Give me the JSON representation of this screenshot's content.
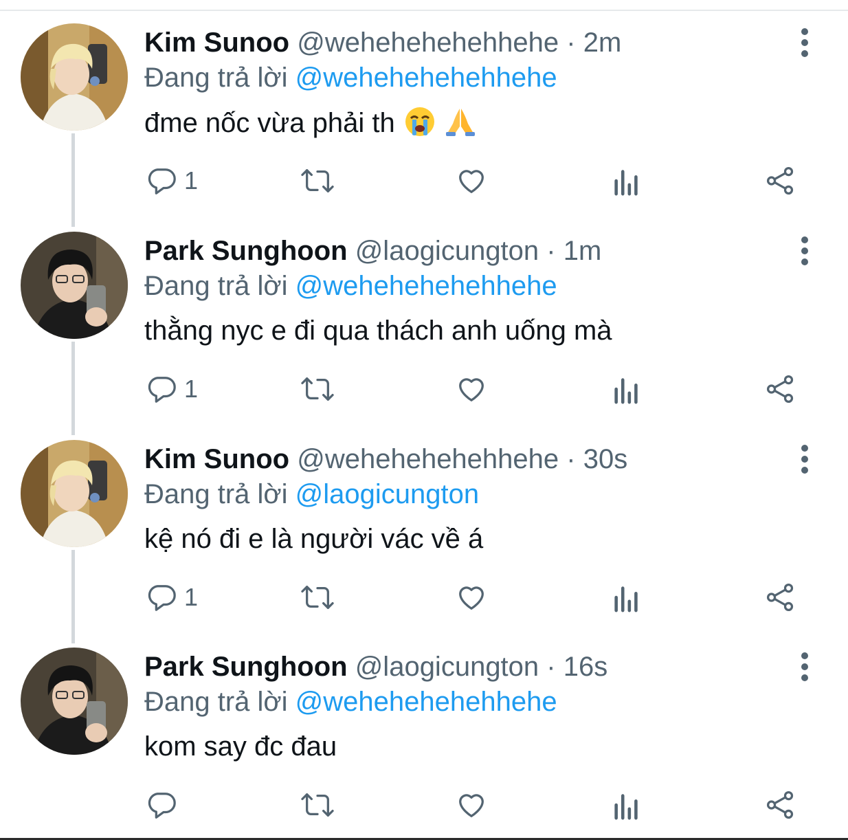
{
  "reply_prefix": "Đang trả lời",
  "tweets": [
    {
      "name": "Kim Sunoo",
      "handle": "@wehehehehehhehe",
      "sep": "·",
      "time": "2m",
      "reply_to": "@wehehehehehhehe",
      "text": "đme nốc vừa phải th",
      "emojis": [
        "loudly-crying-face",
        "folded-hands"
      ],
      "replies": "1",
      "avatar": "avatar-blond"
    },
    {
      "name": "Park Sunghoon",
      "handle": "@laogicungton",
      "sep": "·",
      "time": "1m",
      "reply_to": "@wehehehehehhehe",
      "text": "thằng nyc e đi qua thách anh uống mà",
      "replies": "1",
      "avatar": "avatar-dark-hair"
    },
    {
      "name": "Kim Sunoo",
      "handle": "@wehehehehehhehe",
      "sep": "·",
      "time": "30s",
      "reply_to": "@laogicungton",
      "text": "kệ nó đi e là người vác về á",
      "replies": "1",
      "avatar": "avatar-blond"
    },
    {
      "name": "Park Sunghoon",
      "handle": "@laogicungton",
      "sep": "·",
      "time": "16s",
      "reply_to": "@wehehehehehhehe",
      "text": "kom say đc đau",
      "replies": "",
      "avatar": "avatar-dark-hair"
    }
  ],
  "colors": {
    "name": "#0f1419",
    "secondary": "#536471",
    "mention": "#1d9bf0",
    "thread_line": "#d3d8dc",
    "icon": "#536471"
  }
}
